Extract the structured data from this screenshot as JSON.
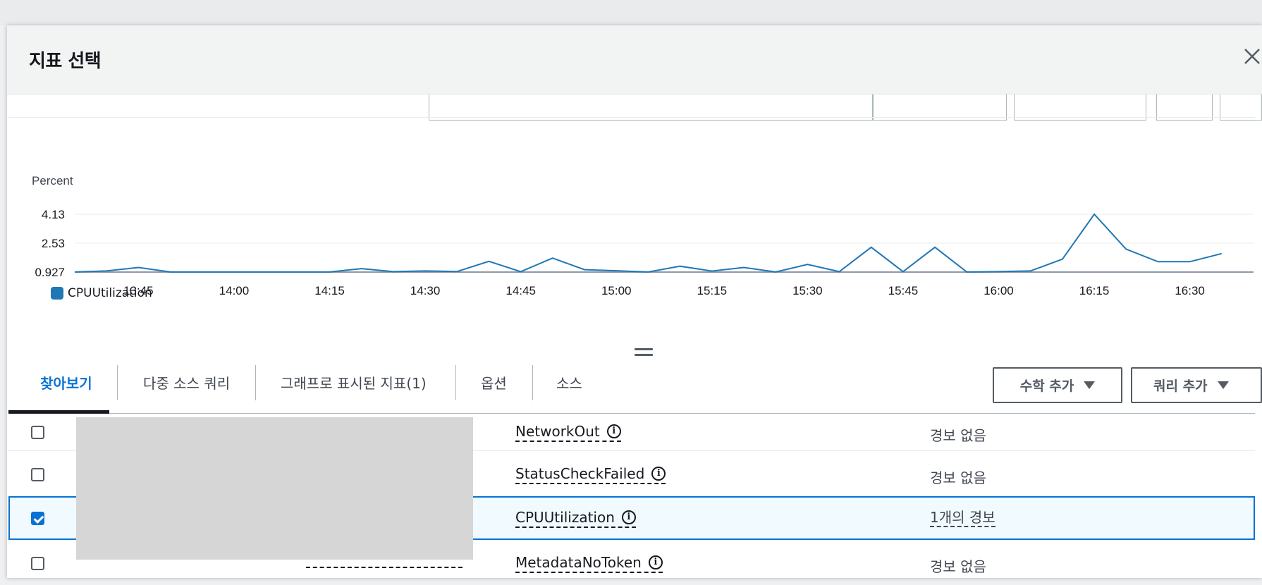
{
  "modal": {
    "title": "지표 선택"
  },
  "chart_data": {
    "type": "line",
    "ylabel": "Percent",
    "y_ticks": [
      "4.13",
      "2.53",
      "0.927"
    ],
    "y_tick_values": [
      4.13,
      2.53,
      0.927
    ],
    "ylim": [
      0.927,
      4.13
    ],
    "x_tick_labels": [
      "13:45",
      "14:00",
      "14:15",
      "14:30",
      "14:45",
      "15:00",
      "15:15",
      "15:30",
      "15:45",
      "16:00",
      "16:15",
      "16:30"
    ],
    "x_start_minutes": 815,
    "x_step_minutes": 5,
    "x_range_minutes": [
      815,
      1000
    ],
    "series": [
      {
        "name": "CPUUtilization",
        "color": "#1f77b4",
        "values": [
          0.93,
          0.99,
          1.18,
          0.93,
          0.93,
          0.93,
          0.93,
          0.93,
          0.93,
          1.12,
          0.95,
          0.99,
          0.96,
          1.52,
          0.95,
          1.7,
          1.06,
          1.0,
          0.93,
          1.25,
          0.98,
          1.18,
          0.93,
          1.35,
          0.95,
          2.3,
          0.95,
          2.3,
          0.93,
          0.95,
          0.99,
          1.64,
          4.13,
          2.2,
          1.5,
          1.5,
          1.95
        ]
      }
    ],
    "legend": "bottom-left",
    "grid": true
  },
  "tabs": [
    {
      "label": "찾아보기",
      "active": true
    },
    {
      "label": "다중 소스 쿼리"
    },
    {
      "label": "그래프로 표시된 지표(1)"
    },
    {
      "label": "옵션"
    },
    {
      "label": "소스"
    }
  ],
  "buttons": {
    "add_math": "수학 추가",
    "add_query": "쿼리 추가"
  },
  "rows": [
    {
      "metric": "NetworkOut",
      "alarm": "경보 없음",
      "checked": false
    },
    {
      "metric": "StatusCheckFailed",
      "alarm": "경보 없음",
      "checked": false
    },
    {
      "metric": "CPUUtilization",
      "alarm": "1개의 경보",
      "checked": true
    },
    {
      "metric": "MetadataNoToken",
      "alarm": "경보 없음",
      "checked": false
    }
  ],
  "colors": {
    "accent": "#0972d3",
    "series": "#1f77b4"
  }
}
